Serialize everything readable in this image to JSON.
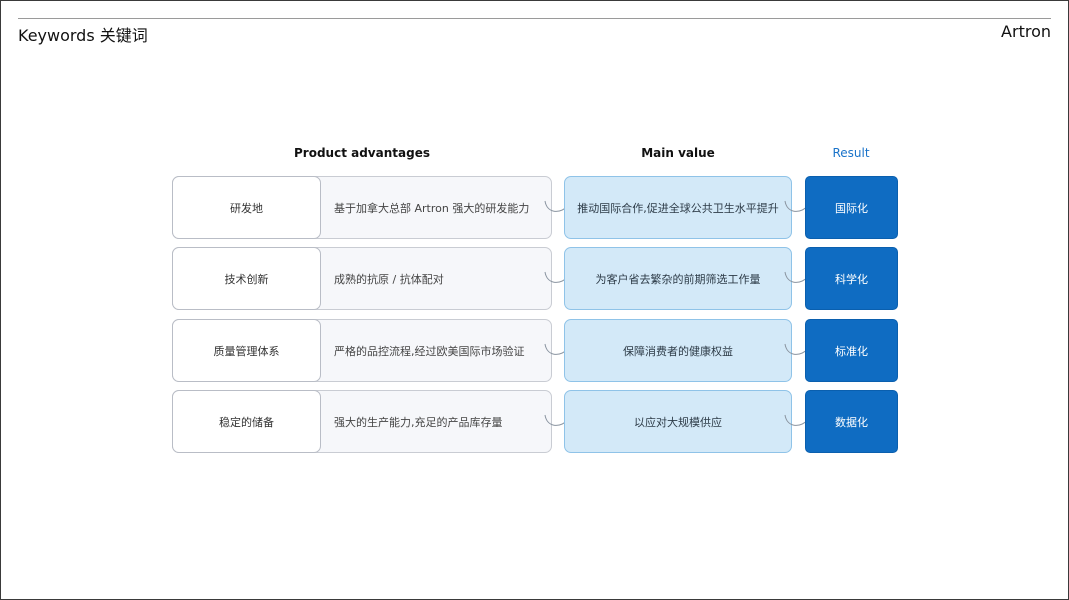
{
  "header": {
    "title": "Keywords 关键词",
    "brand": "Artron"
  },
  "columns": {
    "advantages": "Product advantages",
    "main_value": "Main value",
    "result": "Result"
  },
  "colors": {
    "result_accent": "#1a73c9",
    "result_fill": "#0f6cc2",
    "main_fill": "#d3e9f8",
    "main_border": "#8fc3e8",
    "advantage_fill": "#f6f7fa"
  },
  "rows": [
    {
      "category": "研发地",
      "advantage": "基于加拿大总部 Artron 强大的研发能力",
      "main_value": "推动国际合作,促进全球公共卫生水平提升",
      "result": "国际化"
    },
    {
      "category": "技术创新",
      "advantage": "成熟的抗原 / 抗体配对",
      "main_value": "为客户省去繁杂的前期筛选工作量",
      "result": "科学化"
    },
    {
      "category": "质量管理体系",
      "advantage": "严格的品控流程,经过欧美国际市场验证",
      "main_value": "保障消费者的健康权益",
      "result": "标准化"
    },
    {
      "category": "稳定的储备",
      "advantage": "强大的生产能力,充足的产品库存量",
      "main_value": "以应对大规模供应",
      "result": "数据化"
    }
  ]
}
